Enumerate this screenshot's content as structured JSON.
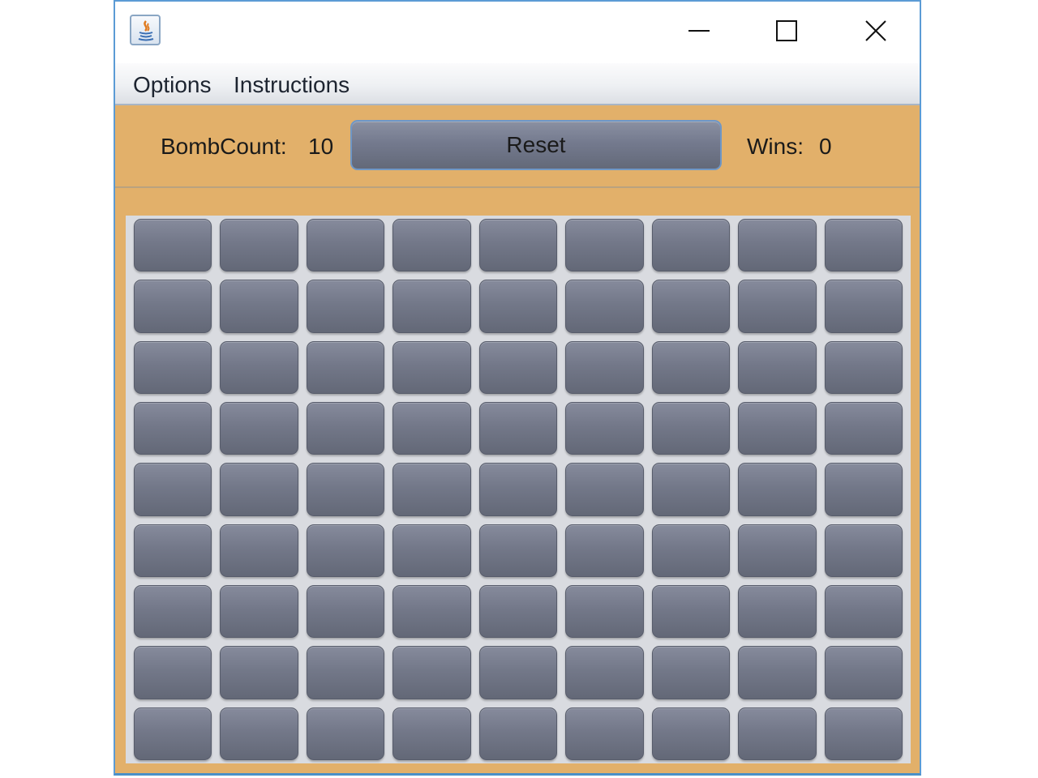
{
  "window": {
    "controls": {
      "minimize_icon": "minimize-icon",
      "maximize_icon": "maximize-icon",
      "close_icon": "close-icon"
    },
    "app_icon": "java-icon",
    "accent_color": "#5b9bd5"
  },
  "menubar": {
    "items": [
      {
        "label": "Options"
      },
      {
        "label": "Instructions"
      }
    ]
  },
  "toolbar": {
    "bomb_label": "BombCount:",
    "bomb_value": "10",
    "reset_label": "Reset",
    "wins_label": "Wins:",
    "wins_value": "0",
    "background_color": "#e2b06a"
  },
  "board": {
    "rows": 9,
    "columns": 9,
    "cell_state": "unrevealed",
    "cell_color": "#737889"
  }
}
